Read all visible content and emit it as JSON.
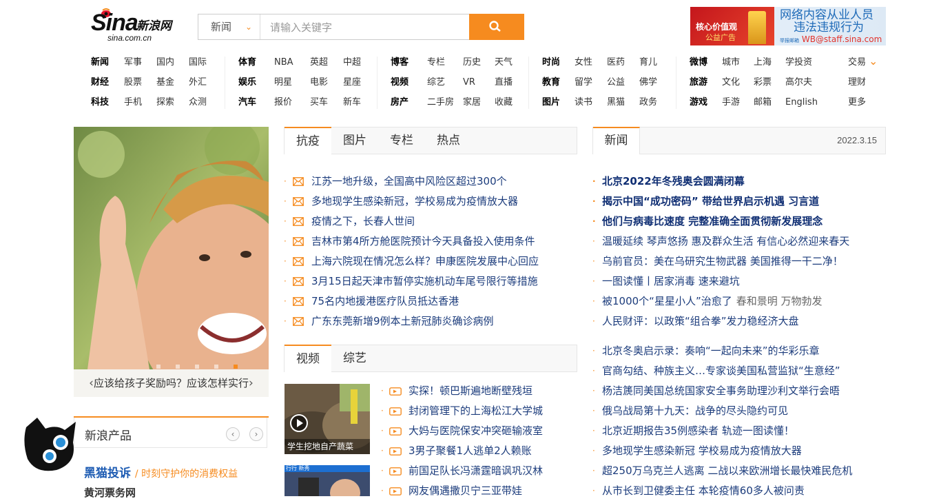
{
  "header": {
    "logo_mark": "Sina",
    "logo_cn": "新浪网",
    "logo_domain": "sina.com.cn",
    "search_category": "新闻",
    "search_placeholder": "请输入关键字",
    "ad": {
      "red_line1": "核心价值观",
      "red_line2": "公益广告",
      "line1": "网络内容从业人员",
      "line2": "违法违规行为",
      "line3_small": "举报邮箱",
      "line3": "WB@staff.sina.com"
    }
  },
  "nav": {
    "columns": [
      {
        "head": [
          "新闻",
          "财经",
          "科技"
        ],
        "items": [
          [
            "军事",
            "国内",
            "国际"
          ],
          [
            "股票",
            "基金",
            "外汇"
          ],
          [
            "手机",
            "探索",
            "众测"
          ]
        ]
      },
      {
        "head": [
          "体育",
          "娱乐",
          "汽车"
        ],
        "items": [
          [
            "NBA",
            "英超",
            "中超"
          ],
          [
            "明星",
            "电影",
            "星座"
          ],
          [
            "报价",
            "买车",
            "新车"
          ]
        ]
      },
      {
        "head": [
          "博客",
          "视频",
          "房产"
        ],
        "items": [
          [
            "专栏",
            "历史",
            "天气"
          ],
          [
            "综艺",
            "VR",
            "直播"
          ],
          [
            "二手房",
            "家居",
            "收藏"
          ]
        ]
      },
      {
        "head": [
          "时尚",
          "教育",
          "图片"
        ],
        "items": [
          [
            "女性",
            "医药",
            "育儿"
          ],
          [
            "留学",
            "公益",
            "佛学"
          ],
          [
            "读书",
            "黑猫",
            "政务"
          ]
        ]
      },
      {
        "head": [
          "微博",
          "旅游",
          "游戏"
        ],
        "items": [
          [
            "城市",
            "上海",
            "学投资"
          ],
          [
            "文化",
            "彩票",
            "高尔夫"
          ],
          [
            "手游",
            "邮箱",
            "English"
          ]
        ]
      }
    ],
    "extra": [
      "交易",
      "理财",
      "更多"
    ]
  },
  "hero": {
    "caption": "应该给孩子奖励吗？应该怎样实行",
    "dots": 5,
    "active_dot": 5
  },
  "products": {
    "title": "新浪产品",
    "line1_main": "黑猫投诉",
    "line1_sub": "/ 时刻守护你的消费权益",
    "line2": "黄河票务网"
  },
  "middle": {
    "tabs": [
      "抗疫",
      "图片",
      "专栏",
      "热点"
    ],
    "items": [
      "江苏一地升级，全国高中风险区超过300个",
      "多地现学生感染新冠，学校易成为疫情放大器",
      "疫情之下，长春人世间",
      "吉林市第4所方舱医院预计今天具备投入使用条件",
      "上海六院现在情况怎么样？申康医院发展中心回应",
      "3月15日起天津市暂停实施机动车尾号限行等措施",
      "75名内地援港医疗队员抵达香港",
      "广东东莞新增9例本土新冠肺炎确诊病例"
    ],
    "video_tabs": [
      "视频",
      "综艺"
    ],
    "video_thumb_caption": "学生挖地自产蔬菜",
    "video_thumb2_caption": "行行 新秀",
    "video_items": [
      "实探！顿巴斯遍地断壁残垣",
      "封闭管理下的上海松江大学城",
      "大妈与医院保安冲突砸输液室",
      "3男子聚餐1人逃单2人赖账",
      "前国足队长冯潇霆暗讽巩汉林",
      "网友偶遇撒贝宁三亚带娃"
    ]
  },
  "right": {
    "tab": "新闻",
    "date": "2022.3.15",
    "bold_items": [
      "北京2022年冬残奥会圆满闭幕",
      "揭示中国“成功密码” 带给世界启示机遇 习言道",
      "他们与病毒比速度 完整准确全面贯彻新发展理念"
    ],
    "items": [
      "温暖延续 琴声悠扬 惠及群众生活 有信心必然迎来春天",
      "乌前官员：美在乌研究生物武器 美国推得一干二净！",
      "一图读懂丨居家消毒 速来避坑",
      "被1000个“星星小人”治愈了",
      "人民财评：以政策“组合拳”发力稳经济大盘"
    ],
    "item4_gray": "春和景明 万物勃发",
    "items2": [
      "北京冬奥启示录：奏响“一起向未来”的华彩乐章",
      "官商勾结、种族主义…专家谈美国私营监狱“生意经”",
      "杨洁篪同美国总统国家安全事务助理沙利文举行会晤",
      "俄乌战局第十九天：战争的尽头隐约可见",
      "北京近期报告35例感染者 轨迹一图读懂！",
      "多地现学生感染新冠 学校易成为疫情放大器",
      "超250万乌克兰人逃离 二战以来欧洲增长最快难民危机",
      "从市长到卫健委主任 本轮疫情60多人被问责"
    ]
  },
  "colors": {
    "accent": "#f68b1f",
    "link": "#1c3c7c",
    "link_bold": "#0f2e73"
  },
  "icons": {
    "search": "search-icon",
    "mail": "mail-icon",
    "video": "video-icon",
    "play": "play-icon"
  }
}
